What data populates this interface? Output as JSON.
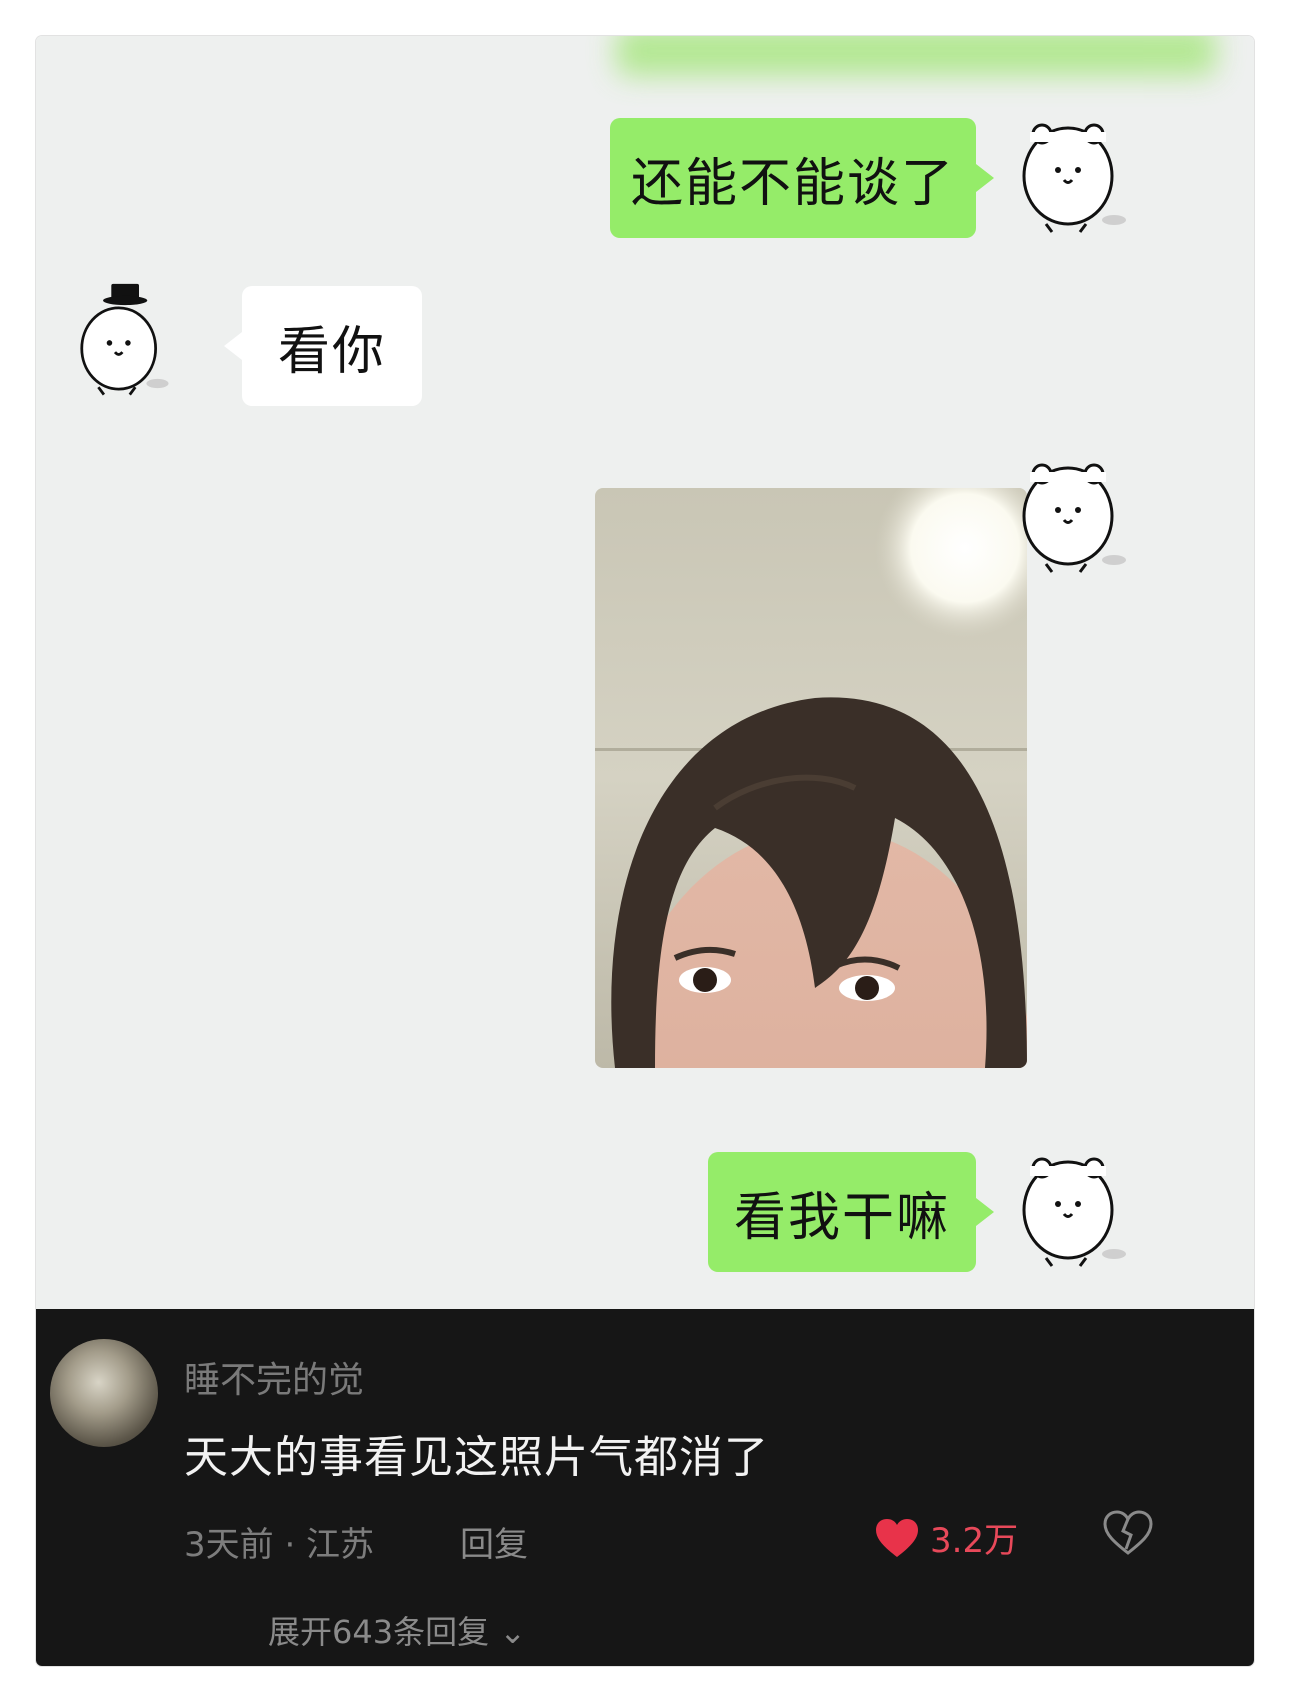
{
  "chat": {
    "messages": [
      {
        "side": "right",
        "type": "text",
        "text": "还能不能谈了"
      },
      {
        "side": "left",
        "type": "text",
        "text": "看你"
      },
      {
        "side": "right",
        "type": "image"
      },
      {
        "side": "right",
        "type": "text",
        "text": "看我干嘛"
      }
    ]
  },
  "comment": {
    "username": "睡不完的觉",
    "text": "天大的事看见这照片气都消了",
    "meta": "3天前 · 江苏",
    "reply_label": "回复",
    "like_count": "3.2万",
    "expand_label": "展开643条回复",
    "like_color": "#e8495a"
  },
  "colors": {
    "sent_bubble": "#95ec69",
    "received_bubble": "#ffffff",
    "chat_background": "#eef0ef",
    "comment_background": "#161616"
  }
}
